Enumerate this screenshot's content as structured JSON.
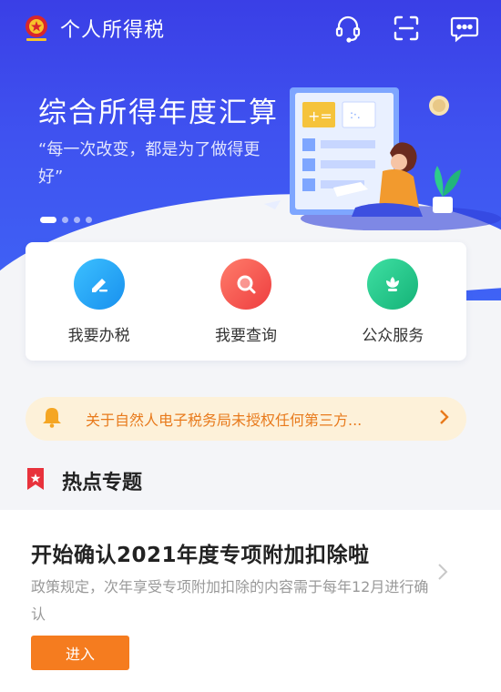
{
  "header": {
    "app_title": "个人所得税",
    "icons": [
      "emblem-icon",
      "customer-service-icon",
      "scan-icon",
      "message-icon"
    ]
  },
  "banner": {
    "title": "综合所得年度汇算",
    "subtitle": "“每一次改变，都是为了做得更好”",
    "dots": 4,
    "active_dot": 0
  },
  "quick_actions": [
    {
      "label": "我要办税",
      "icon": "edit-icon",
      "color": "#1aa3f0"
    },
    {
      "label": "我要查询",
      "icon": "search-icon",
      "color": "#f0514d"
    },
    {
      "label": "公众服务",
      "icon": "service-flower-icon",
      "color": "#1fc28a"
    }
  ],
  "notice": {
    "text": "关于自然人电子税务局未授权任何第三方...",
    "icon": "bell-icon",
    "text_color": "#e87a1c"
  },
  "hot_topics": {
    "section_title": "热点专题",
    "card": {
      "title": "开始确认2021年度专项附加扣除啦",
      "description": "政策规定，次年享受专项附加扣除的内容需于每年12月进行确认",
      "button_label": "进入"
    }
  },
  "colors": {
    "brand_blue": "#3f52f0",
    "accent_orange": "#f57c1f"
  }
}
